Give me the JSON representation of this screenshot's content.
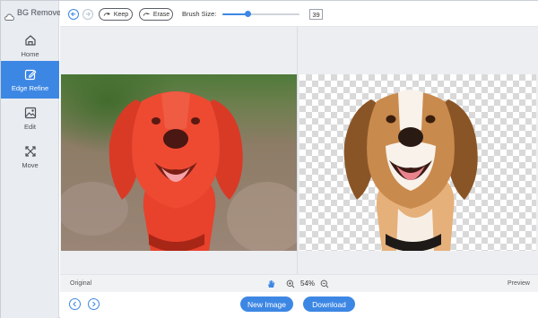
{
  "app": {
    "title": "BG Remover"
  },
  "sidebar": {
    "items": [
      {
        "label": "Home",
        "icon": "home-icon",
        "active": false
      },
      {
        "label": "Edge Refine",
        "icon": "edit-pen-icon",
        "active": true
      },
      {
        "label": "Edit",
        "icon": "image-edit-icon",
        "active": false
      },
      {
        "label": "Move",
        "icon": "move-arrows-icon",
        "active": false
      }
    ]
  },
  "toolbar": {
    "undo_icon": "undo-icon",
    "redo_icon": "redo-icon",
    "keep_label": "Keep",
    "erase_label": "Erase",
    "brush_label": "Brush Size:",
    "brush_size": "39",
    "brush_fraction": 0.33
  },
  "status": {
    "original_label": "Original",
    "preview_label": "Preview",
    "zoom": "54%"
  },
  "bottom": {
    "new_image_label": "New Image",
    "download_label": "Download"
  },
  "colors": {
    "accent": "#3d87e4",
    "sidebar_bg": "#e9ecf0",
    "mask_red": "#e8412c"
  }
}
